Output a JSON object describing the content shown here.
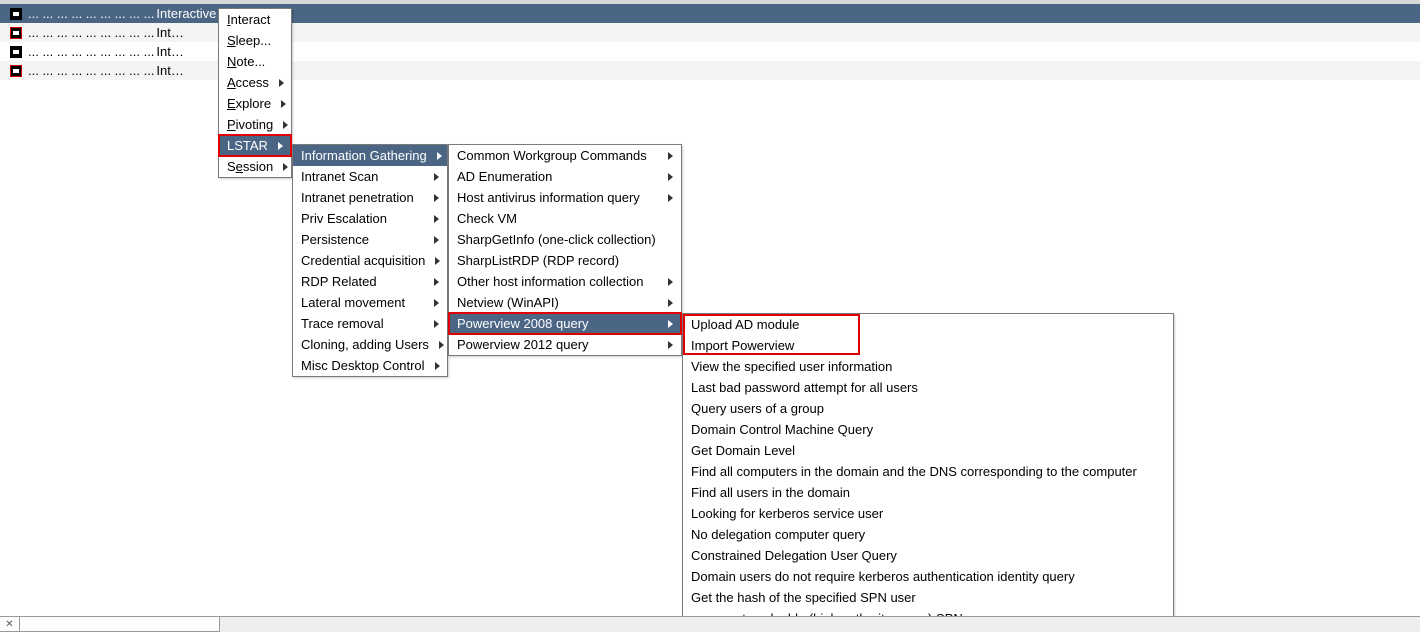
{
  "rows": [
    {
      "selected": true,
      "red": false,
      "text": "Interactive",
      "dots": "...  ...  ...  ...  ...      ...  ...  ...  ..."
    },
    {
      "selected": false,
      "red": true,
      "text": "Int…",
      "dots": "...  ...  ...  ...  ...      ...  ...  ...  ..."
    },
    {
      "selected": false,
      "red": false,
      "text": "Int…",
      "dots": "...  ...  ...  ...  ...      ...  ...  ...  ..."
    },
    {
      "selected": false,
      "red": true,
      "text": "Int…",
      "dots": "...  ...  ...  ...  ...      ...  ...  ...  ..."
    }
  ],
  "menu1": {
    "items": [
      {
        "label": "Interact",
        "sub": false,
        "ul": "I"
      },
      {
        "label": "Sleep...",
        "sub": false,
        "ul": "S"
      },
      {
        "label": "Note...",
        "sub": false,
        "ul": "N"
      },
      {
        "label": "Access",
        "sub": true,
        "ul": "A"
      },
      {
        "label": "Explore",
        "sub": true,
        "ul": "E"
      },
      {
        "label": "Pivoting",
        "sub": true,
        "ul": "P"
      },
      {
        "label": "LSTAR",
        "sub": true,
        "highlight": true,
        "boxed": true
      },
      {
        "label": "Session",
        "sub": true,
        "ul": "e",
        "ulidx": 1
      }
    ]
  },
  "menu2": {
    "items": [
      {
        "label": "Information Gathering",
        "sub": true,
        "highlight": true
      },
      {
        "label": "Intranet Scan",
        "sub": true
      },
      {
        "label": "Intranet penetration",
        "sub": true
      },
      {
        "label": "Priv Escalation",
        "sub": true
      },
      {
        "label": "Persistence",
        "sub": true
      },
      {
        "label": "Credential acquisition",
        "sub": true
      },
      {
        "label": "RDP Related",
        "sub": true
      },
      {
        "label": "Lateral movement",
        "sub": true
      },
      {
        "label": "Trace removal",
        "sub": true
      },
      {
        "label": "Cloning, adding Users",
        "sub": true
      },
      {
        "label": "Misc Desktop Control",
        "sub": true
      }
    ]
  },
  "menu3": {
    "items": [
      {
        "label": "Common Workgroup Commands",
        "sub": true
      },
      {
        "label": "AD Enumeration",
        "sub": true
      },
      {
        "label": "Host antivirus information query",
        "sub": true
      },
      {
        "label": "Check VM",
        "sub": false
      },
      {
        "label": "SharpGetInfo (one-click collection)",
        "sub": false
      },
      {
        "label": "SharpListRDP (RDP record)",
        "sub": false
      },
      {
        "label": "Other host information collection",
        "sub": true
      },
      {
        "label": "Netview (WinAPI)",
        "sub": true
      },
      {
        "label": "Powerview 2008 query",
        "sub": true,
        "highlight": true,
        "boxed": true
      },
      {
        "label": "Powerview 2012 query",
        "sub": true
      }
    ]
  },
  "menu4": {
    "items": [
      {
        "label": "Upload AD module",
        "boxed_group": true
      },
      {
        "label": "Import Powerview",
        "boxed_group": true
      },
      {
        "label": "View the specified user information"
      },
      {
        "label": "Last bad password attempt for all users"
      },
      {
        "label": "Query users of a group"
      },
      {
        "label": "Domain Control Machine Query"
      },
      {
        "label": "Get Domain Level"
      },
      {
        "label": "Find all computers in the domain and the DNS corresponding to the computer"
      },
      {
        "label": "Find all users in the domain"
      },
      {
        "label": "Looking for kerberos service user"
      },
      {
        "label": "No delegation computer query"
      },
      {
        "label": "Constrained Delegation User Query"
      },
      {
        "label": "Domain users do not require kerberos authentication identity query"
      },
      {
        "label": "Get the hash of the specified SPN user"
      },
      {
        "label": "enumerate valuable (high authority group) SPN users"
      }
    ]
  }
}
